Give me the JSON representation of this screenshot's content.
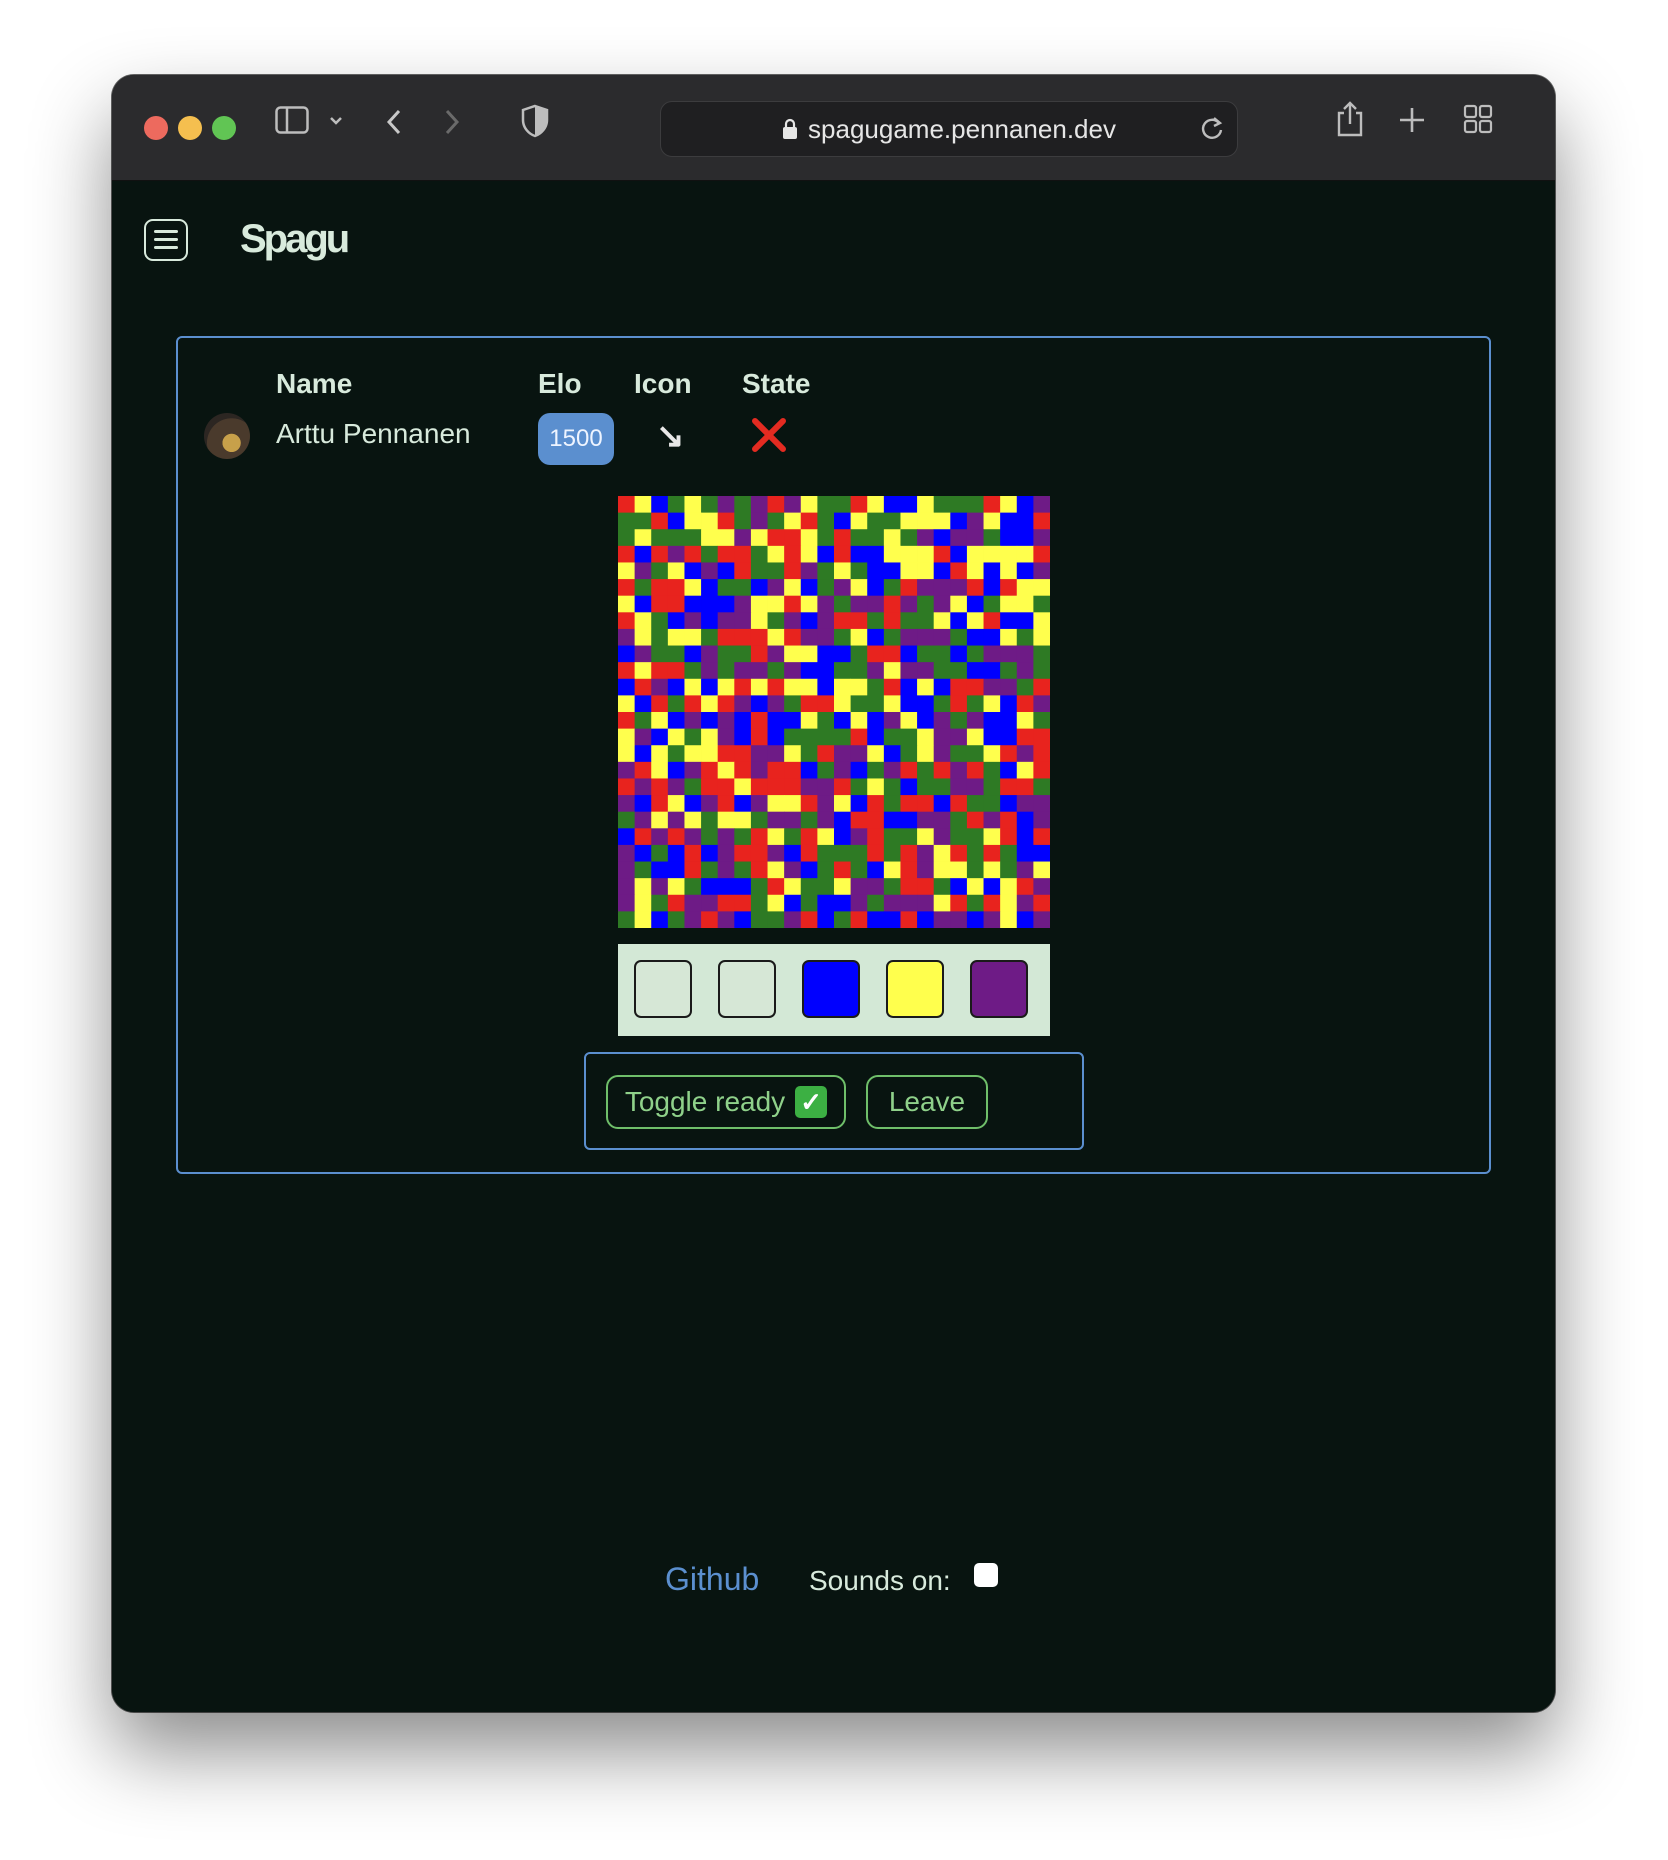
{
  "browser": {
    "url": "spagugame.pennanen.dev"
  },
  "app": {
    "brand": "Spagu"
  },
  "lobby": {
    "headers": {
      "name": "Name",
      "elo": "Elo",
      "icon": "Icon",
      "state": "State"
    },
    "player": {
      "name": "Arttu Pennanen",
      "elo": "1500",
      "icon": "↘",
      "state": "not-ready-cross-icon"
    }
  },
  "board": {
    "cols": 26,
    "rows": 26,
    "colors": [
      "#e8231e",
      "#2e7a24",
      "#0000ff",
      "#ffff4d",
      "#6e1b86"
    ]
  },
  "palette": {
    "swatches": [
      "#d6e7d6",
      "#d6e7d6",
      "#0000ff",
      "#ffff4d",
      "#6e1b86"
    ]
  },
  "buttons": {
    "toggle_ready": "Toggle ready",
    "toggle_ready_emoji": "✓",
    "leave": "Leave"
  },
  "footer": {
    "github": "Github",
    "sounds_label": "Sounds on:",
    "sounds_on": false
  }
}
